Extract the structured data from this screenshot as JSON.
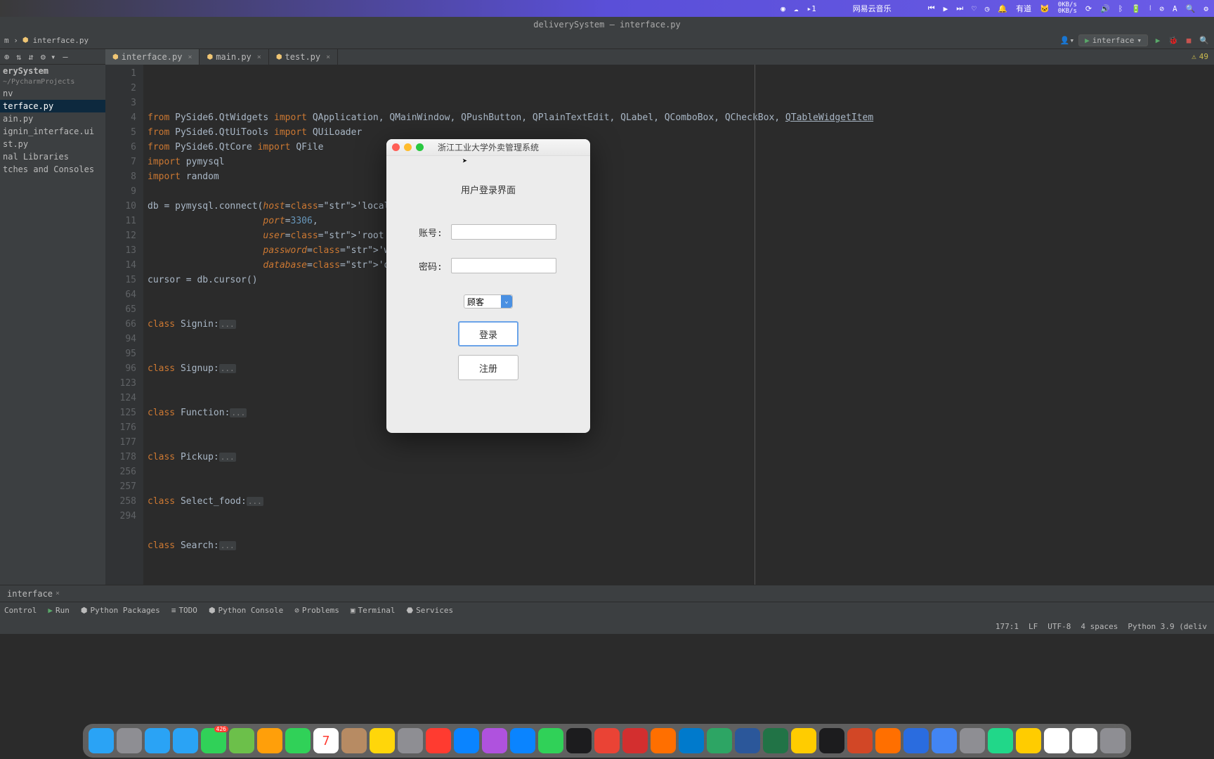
{
  "menubar": {
    "app_name": "网易云音乐",
    "badge": "1",
    "net_up": "0KB/s",
    "net_down": "0KB/s"
  },
  "ide": {
    "title": "deliverySystem – interface.py",
    "breadcrumb_file": "interface.py",
    "run_config": "interface",
    "warning_count": "49"
  },
  "sidebar": {
    "project": "erySystem",
    "project_path": "~/PycharmProjects",
    "items": [
      "nv",
      "terface.py",
      "ain.py",
      "ignin_interface.ui",
      "st.py",
      "nal Libraries",
      "tches and Consoles"
    ]
  },
  "tabs": [
    {
      "label": "interface.py",
      "active": true
    },
    {
      "label": "main.py",
      "active": false
    },
    {
      "label": "test.py",
      "active": false
    }
  ],
  "gutter_lines": [
    "1",
    "2",
    "3",
    "4",
    "5",
    "6",
    "7",
    "8",
    "9",
    "10",
    "11",
    "12",
    "13",
    "14",
    "15",
    "64",
    "65",
    "66",
    "94",
    "95",
    "96",
    "123",
    "124",
    "125",
    "176",
    "177",
    "178",
    "256",
    "257",
    "258",
    "294"
  ],
  "code_lines": [
    {
      "t": "from PySide6.QtWidgets import QApplication, QMainWindow, QPushButton, QPlainTextEdit, QLabel, QComboBox, QCheckBox, QTableWidgetItem"
    },
    {
      "t": "from PySide6.QtUiTools import QUiLoader"
    },
    {
      "t": "from PySide6.QtCore import QFile"
    },
    {
      "t": "import pymysql"
    },
    {
      "t": "import random"
    },
    {
      "t": ""
    },
    {
      "t": "db = pymysql.connect(host='localhost',"
    },
    {
      "t": "                     port=3306,"
    },
    {
      "t": "                     user='root',"
    },
    {
      "t": "                     password='wang1234',"
    },
    {
      "t": "                     database='delivery_sys')"
    },
    {
      "t": "cursor = db.cursor()"
    },
    {
      "t": ""
    },
    {
      "t": ""
    },
    {
      "t": "class Signin:..."
    },
    {
      "t": ""
    },
    {
      "t": ""
    },
    {
      "t": "class Signup:..."
    },
    {
      "t": ""
    },
    {
      "t": ""
    },
    {
      "t": "class Function:..."
    },
    {
      "t": ""
    },
    {
      "t": ""
    },
    {
      "t": "class Pickup:..."
    },
    {
      "t": ""
    },
    {
      "t": ""
    },
    {
      "t": "class Select_food:..."
    },
    {
      "t": ""
    },
    {
      "t": ""
    },
    {
      "t": "class Search:..."
    },
    {
      "t": ""
    }
  ],
  "bottom_tab": "interface",
  "tool_buttons": [
    "Control",
    "Run",
    "Python Packages",
    "TODO",
    "Python Console",
    "Problems",
    "Terminal",
    "Services"
  ],
  "statusbar": {
    "pos": "177:1",
    "lf": "LF",
    "enc": "UTF-8",
    "indent": "4 spaces",
    "interpreter": "Python 3.9 (deliv"
  },
  "dialog": {
    "title": "浙江工业大学外卖管理系统",
    "heading": "用户登录界面",
    "label_user": "账号:",
    "label_pass": "密码:",
    "combo_value": "顾客",
    "btn_login": "登录",
    "btn_register": "注册"
  },
  "dock_icons": [
    "finder",
    "launchpad",
    "safari",
    "mail",
    "messages",
    "maps",
    "photos",
    "facetime",
    "calendar",
    "contacts",
    "notes",
    "settings",
    "music",
    "appstore",
    "podcasts",
    "qq",
    "wechat",
    "terminal",
    "chrome",
    "youdao",
    "matlab",
    "vscode",
    "dingtalk",
    "word",
    "excel",
    "pages",
    "idea",
    "ppt",
    "wps",
    "baidu",
    "paper",
    "app",
    "pycharm",
    "pen",
    "doc1",
    "doc2",
    "trash"
  ]
}
